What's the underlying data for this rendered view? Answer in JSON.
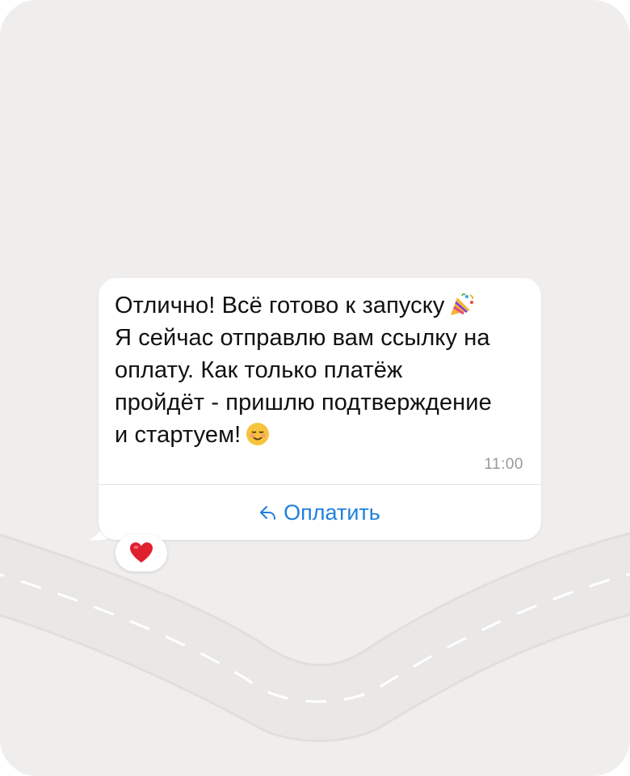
{
  "message": {
    "lines": [
      "Отлично! Всё готово к запуску",
      "Я сейчас отправлю вам ссылку на",
      "оплату. Как только платёж",
      "пройдёт - пришлю подтверждение",
      "и стартуем!"
    ],
    "line1_emoji": "party-popper",
    "line5_emoji": "smiling-face",
    "time": "11:00"
  },
  "action_button": {
    "label": "Оплатить",
    "icon": "reply-arrow-icon"
  },
  "reaction": {
    "emoji": "red-heart"
  },
  "colors": {
    "background": "#efeeed",
    "bubble": "#ffffff",
    "text": "#111111",
    "timestamp": "#9a9a9f",
    "accent": "#1f7fde",
    "heart": "#e0202f"
  }
}
